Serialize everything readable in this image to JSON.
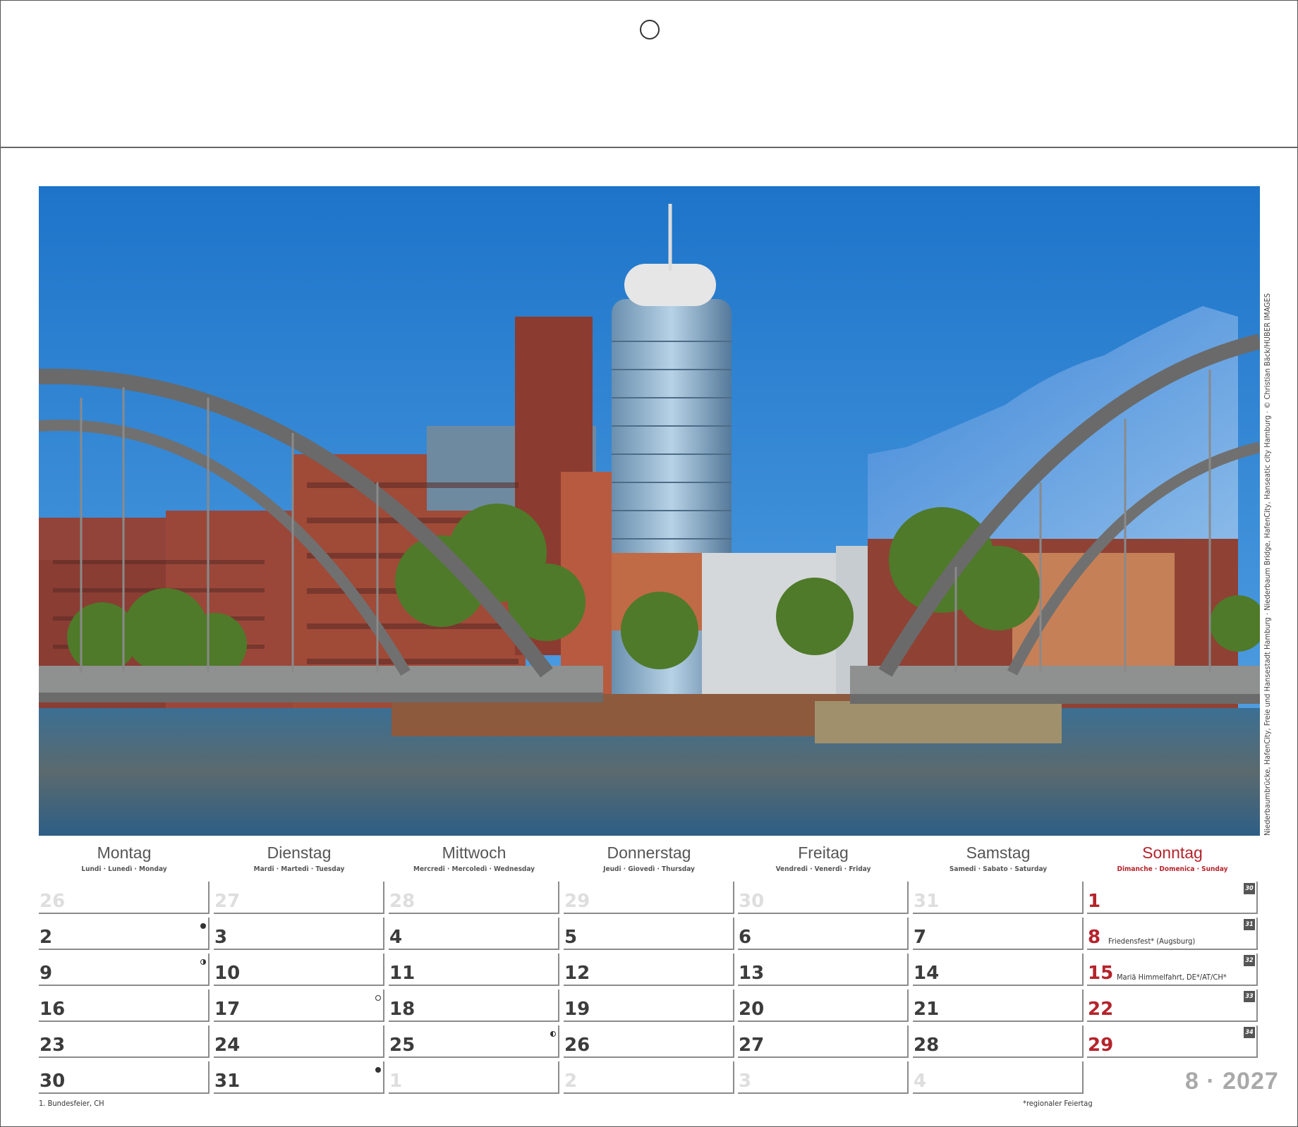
{
  "credit": "Niederbaumbrücke, HafenCity, Freie und Hansestadt Hamburg · Niederbaum Bridge, HafenCity, Hanseatic city Hamburg · © Christian Bäck/HUBER IMAGES",
  "weekdays": [
    {
      "name": "Montag",
      "sub": "Lundi · Lunedì · Monday"
    },
    {
      "name": "Dienstag",
      "sub": "Mardi · Martedì · Tuesday"
    },
    {
      "name": "Mittwoch",
      "sub": "Mercredi · Mercoledì · Wednesday"
    },
    {
      "name": "Donnerstag",
      "sub": "Jeudi · Giovedì · Thursday"
    },
    {
      "name": "Freitag",
      "sub": "Vendredi · Venerdì · Friday"
    },
    {
      "name": "Samstag",
      "sub": "Samedi · Sabato · Saturday"
    },
    {
      "name": "Sonntag",
      "sub": "Dimanche · Domenica · Sunday"
    }
  ],
  "weeks": [
    {
      "week_no": "30",
      "days": [
        {
          "d": "26",
          "state": "other"
        },
        {
          "d": "27",
          "state": "other"
        },
        {
          "d": "28",
          "state": "other"
        },
        {
          "d": "29",
          "state": "other"
        },
        {
          "d": "30",
          "state": "other"
        },
        {
          "d": "31",
          "state": "other"
        },
        {
          "d": "1",
          "state": "sunday"
        }
      ]
    },
    {
      "week_no": "31",
      "days": [
        {
          "d": "2",
          "moon": "new"
        },
        {
          "d": "3"
        },
        {
          "d": "4"
        },
        {
          "d": "5"
        },
        {
          "d": "6"
        },
        {
          "d": "7"
        },
        {
          "d": "8",
          "state": "sunday",
          "holiday": "Friedensfest* (Augsburg)"
        }
      ]
    },
    {
      "week_no": "32",
      "days": [
        {
          "d": "9",
          "moon": "first-quarter"
        },
        {
          "d": "10"
        },
        {
          "d": "11"
        },
        {
          "d": "12"
        },
        {
          "d": "13"
        },
        {
          "d": "14"
        },
        {
          "d": "15",
          "state": "sunday",
          "holiday": "Mariä Himmelfahrt, DE*/AT/CH*"
        }
      ]
    },
    {
      "week_no": "33",
      "days": [
        {
          "d": "16"
        },
        {
          "d": "17",
          "moon": "full"
        },
        {
          "d": "18"
        },
        {
          "d": "19"
        },
        {
          "d": "20"
        },
        {
          "d": "21"
        },
        {
          "d": "22",
          "state": "sunday"
        }
      ]
    },
    {
      "week_no": "34",
      "days": [
        {
          "d": "23"
        },
        {
          "d": "24"
        },
        {
          "d": "25",
          "moon": "last-quarter"
        },
        {
          "d": "26"
        },
        {
          "d": "27"
        },
        {
          "d": "28"
        },
        {
          "d": "29",
          "state": "sunday"
        }
      ]
    },
    {
      "week_no": "",
      "days": [
        {
          "d": "30"
        },
        {
          "d": "31",
          "moon": "new"
        },
        {
          "d": "1",
          "state": "other"
        },
        {
          "d": "2",
          "state": "other"
        },
        {
          "d": "3",
          "state": "other"
        },
        {
          "d": "4",
          "state": "other"
        }
      ]
    }
  ],
  "footnote_left": "1. Bundesfeier, CH",
  "footnote_right": "*regionaler Feiertag",
  "month_year": "8 · 2027",
  "colors": {
    "sunday": "#b5232b",
    "text": "#3c3c3c",
    "other_month": "#dedede",
    "sky": "#2f86d4"
  }
}
